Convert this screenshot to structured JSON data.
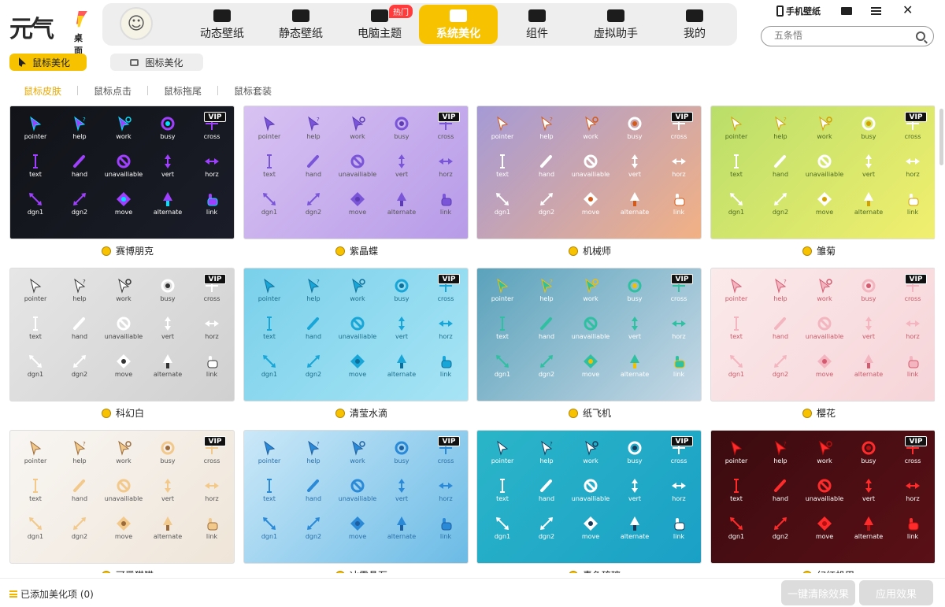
{
  "app": {
    "logo_text": "元气",
    "logo_sub": "桌面"
  },
  "nav": [
    {
      "label": "动态壁纸",
      "icon": "tv-icon"
    },
    {
      "label": "静态壁纸",
      "icon": "image-icon"
    },
    {
      "label": "电脑主题",
      "icon": "shirt-icon"
    },
    {
      "label": "系统美化",
      "icon": "flower-icon",
      "active": true
    },
    {
      "label": "组件",
      "icon": "widget-icon"
    },
    {
      "label": "虚拟助手",
      "icon": "paw-icon"
    },
    {
      "label": "我的",
      "icon": "face-icon"
    }
  ],
  "hot_badge": "热门",
  "toolbar": {
    "phone_wallpaper": "手机壁纸"
  },
  "search": {
    "placeholder": "五条悟"
  },
  "subnav": {
    "mouse": "鼠标美化",
    "icon": "图标美化"
  },
  "tabs": [
    "鼠标皮肤",
    "鼠标点击",
    "鼠标拖尾",
    "鼠标套装"
  ],
  "cursor_labels": [
    "pointer",
    "help",
    "work",
    "busy",
    "cross",
    "text",
    "hand",
    "unavailiable",
    "vert",
    "horz",
    "dgn1",
    "dgn2",
    "move",
    "alternate",
    "link"
  ],
  "vip_label": "VIP",
  "colors": {
    "accent": "#f7c300",
    "hot": "#ff3b3b"
  },
  "cards": [
    {
      "name": "赛博朋克",
      "bg": "#111318",
      "bg2": "#1a1d28",
      "fg": "#ffffff",
      "accent": "#a040ff",
      "accent2": "#00e0ff"
    },
    {
      "name": "紫晶蝶",
      "bg": "#d8c2f2",
      "bg2": "#b79be8",
      "fg": "#555555",
      "accent": "#7a55d8",
      "accent2": "#5c3bb3"
    },
    {
      "name": "机械师",
      "bg": "#a59ad6",
      "bg2": "#f2b184",
      "fg": "#ffffff",
      "accent": "#ffffff",
      "accent2": "#d45a1a"
    },
    {
      "name": "雏菊",
      "bg": "#b9de6a",
      "bg2": "#f2ef6e",
      "fg": "#4d6a20",
      "accent": "#ffffff",
      "accent2": "#d4a000"
    },
    {
      "name": "科幻白",
      "bg": "#e6e6e6",
      "bg2": "#d0d0d0",
      "fg": "#444444",
      "accent": "#ffffff",
      "accent2": "#333333"
    },
    {
      "name": "清莹水滴",
      "bg": "#7ad0ea",
      "bg2": "#a7e4f5",
      "fg": "#1b6d8a",
      "accent": "#18a6d8",
      "accent2": "#0d6f99"
    },
    {
      "name": "纸飞机",
      "bg": "#5aa2bb",
      "bg2": "#c7d9e6",
      "fg": "#ffffff",
      "accent": "#2ec0a0",
      "accent2": "#f2c000"
    },
    {
      "name": "樱花",
      "bg": "#fbeaea",
      "bg2": "#f6d4d8",
      "fg": "#c85a6a",
      "accent": "#f3b5bf",
      "accent2": "#d45a70"
    },
    {
      "name": "可爱猫猫",
      "bg": "#f8f6f3",
      "bg2": "#efe5d8",
      "fg": "#555555",
      "accent": "#f2c98a",
      "accent2": "#9a6a3a"
    },
    {
      "name": "冰雪晶石",
      "bg": "#cbe8f8",
      "bg2": "#6bbbe6",
      "fg": "#2a6fa8",
      "accent": "#2a8ad8",
      "accent2": "#1e5fa0"
    },
    {
      "name": "青色琉璃",
      "bg": "#2bb5c8",
      "bg2": "#1aa0c6",
      "fg": "#ffffff",
      "accent": "#ffffff",
      "accent2": "#173a5a"
    },
    {
      "name": "幻红机甲",
      "bg": "#3a0b0f",
      "bg2": "#5a1016",
      "fg": "#ffffff",
      "accent": "#ff2b2b",
      "accent2": "#b81010"
    }
  ],
  "bottom": {
    "added": "已添加美化项 (0)",
    "clear": "一键清除效果",
    "apply": "应用效果"
  }
}
